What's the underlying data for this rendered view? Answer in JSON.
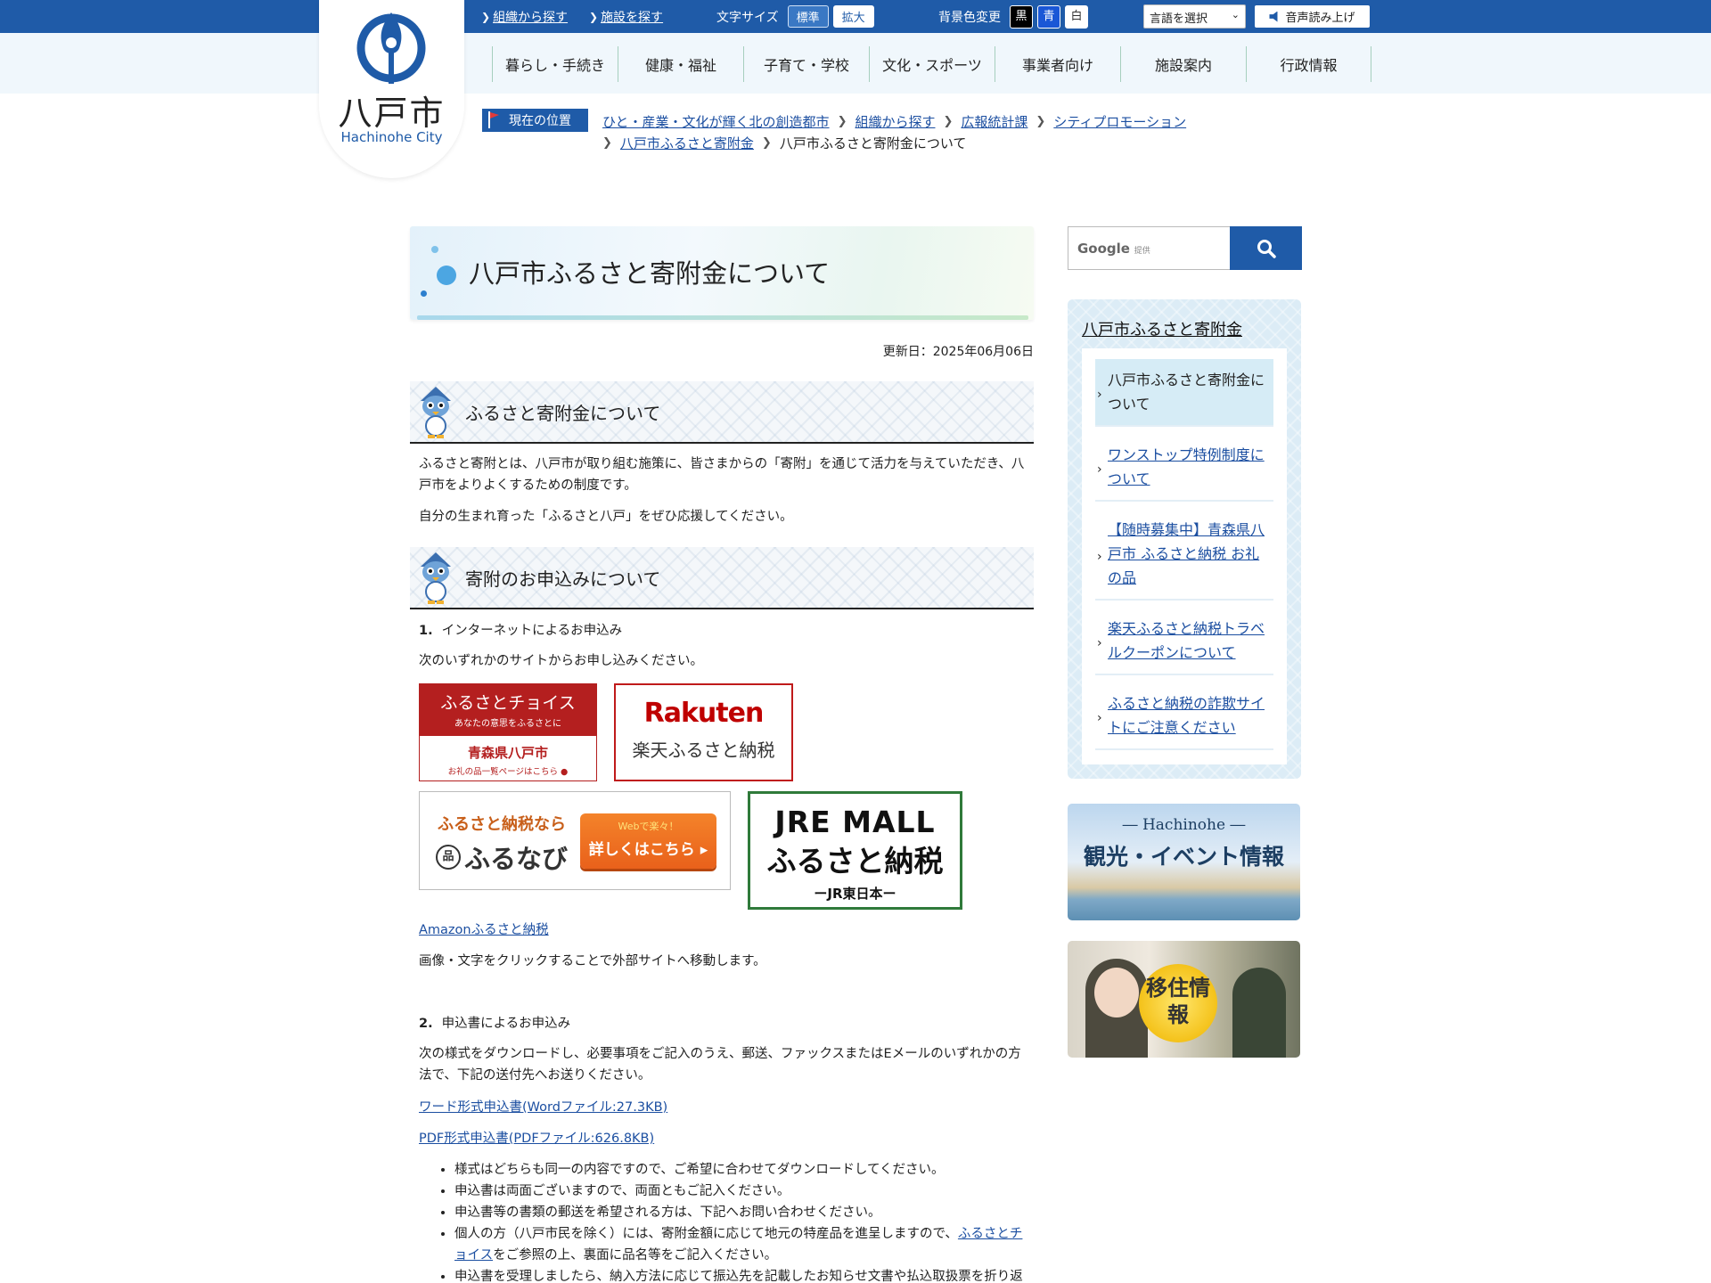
{
  "utility": {
    "link_org": "組織から探す",
    "link_facility": "施設を探す",
    "font_size_label": "文字サイズ",
    "font_standard": "標準",
    "font_large": "拡大",
    "bg_color_label": "背景色変更",
    "bg_black": "黒",
    "bg_blue": "青",
    "bg_white": "白",
    "language_select": "言語を選択",
    "read_aloud": "音声読み上げ"
  },
  "logo": {
    "name": "八戸市",
    "roman": "Hachinohe City"
  },
  "global_nav": [
    "暮らし・手続き",
    "健康・福祉",
    "子育て・学校",
    "文化・スポーツ",
    "事業者向け",
    "施設案内",
    "行政情報"
  ],
  "breadcrumb": {
    "label": "現在の位置",
    "items": [
      "ひと・産業・文化が輝く北の創造都市",
      "組織から探す",
      "広報統計課",
      "シティプロモーション",
      "八戸市ふるさと寄附金"
    ],
    "current": "八戸市ふるさと寄附金について"
  },
  "page": {
    "title": "八戸市ふるさと寄附金について",
    "updated": "更新日：2025年06月06日"
  },
  "sections": {
    "about": {
      "heading": "ふるさと寄附金について",
      "p1": "ふるさと寄附とは、八戸市が取り組む施策に、皆さまからの「寄附」を通じて活力を与えていただき、八戸市をよりよくするための制度です。",
      "p2": "自分の生まれ育った「ふるさと八戸」をぜひ応援してください。"
    },
    "apply": {
      "heading": "寄附のお申込みについて",
      "item1_num": "1.",
      "item1_title": "インターネットによるお申込み",
      "item1_text": "次のいずれかのサイトからお申し込みください。",
      "amazon_link": "Amazonふるさと納税",
      "external_note": "画像・文字をクリックすることで外部サイトへ移動します。",
      "item2_num": "2.",
      "item2_title": "申込書によるお申込み",
      "item2_text": "次の様式をダウンロードし、必要事項をご記入のうえ、郵送、ファックスまたはEメールのいずれかの方法で、下記の送付先へお送りください。",
      "word_link": "ワード形式申込書(Wordファイル:27.3KB)",
      "pdf_link": "PDF形式申込書(PDFファイル:626.8KB)",
      "bullets": {
        "b1": "様式はどちらも同一の内容ですので、ご希望に合わせてダウンロードしてください。",
        "b2": "申込書は両面ございますので、両面ともご記入ください。",
        "b3": "申込書等の書類の郵送を希望される方は、下記へお問い合わせください。",
        "b4_pre": "個人の方（八戸市民を除く）には、寄附金額に応じて地元の特産品を進呈しますので、",
        "b4_link": "ふるさとチョイス",
        "b4_post": "をご参照の上、裏面に品名等をご記入ください。",
        "b5": "申込書を受理しましたら、納入方法に応じて振込先を記載したお知らせ文書や払込取扱票を折り返し"
      }
    }
  },
  "banners": {
    "choice": {
      "t1": "ふるさとチョイス",
      "t2": "あなたの意思をふるさとに",
      "t3": "青森県八戸市",
      "t4": "お礼の品一覧ページはこちら"
    },
    "rakuten": {
      "t1": "Rakuten",
      "t2": "楽天ふるさと納税"
    },
    "furunavi": {
      "t1": "ふるさと納税なら",
      "t2": "ふるなび",
      "btn_small": "Webで楽々！",
      "btn_main": "詳しくはこちら"
    },
    "jre": {
      "t1": "JRE MALL",
      "t2": "ふるさと納税",
      "t3": "ーJR東日本ー"
    }
  },
  "search": {
    "google": "Google",
    "provided": "提供"
  },
  "sidenav": {
    "heading": "八戸市ふるさと寄附金",
    "items": [
      "八戸市ふるさと寄附金について",
      "ワンストップ特例制度について",
      "【随時募集中】青森県八戸市 ふるさと納税 お礼の品",
      "楽天ふるさと納税トラベルクーポンについて",
      "ふるさと納税の詐欺サイトにご注意ください"
    ]
  },
  "side_banners": {
    "tourism_t1": "― Hachinohe ―",
    "tourism_t2": "観光・イベント情報",
    "migration": "移住情報"
  },
  "colors": {
    "brand_blue": "#1f5ba8",
    "link": "#1c4fa1"
  }
}
